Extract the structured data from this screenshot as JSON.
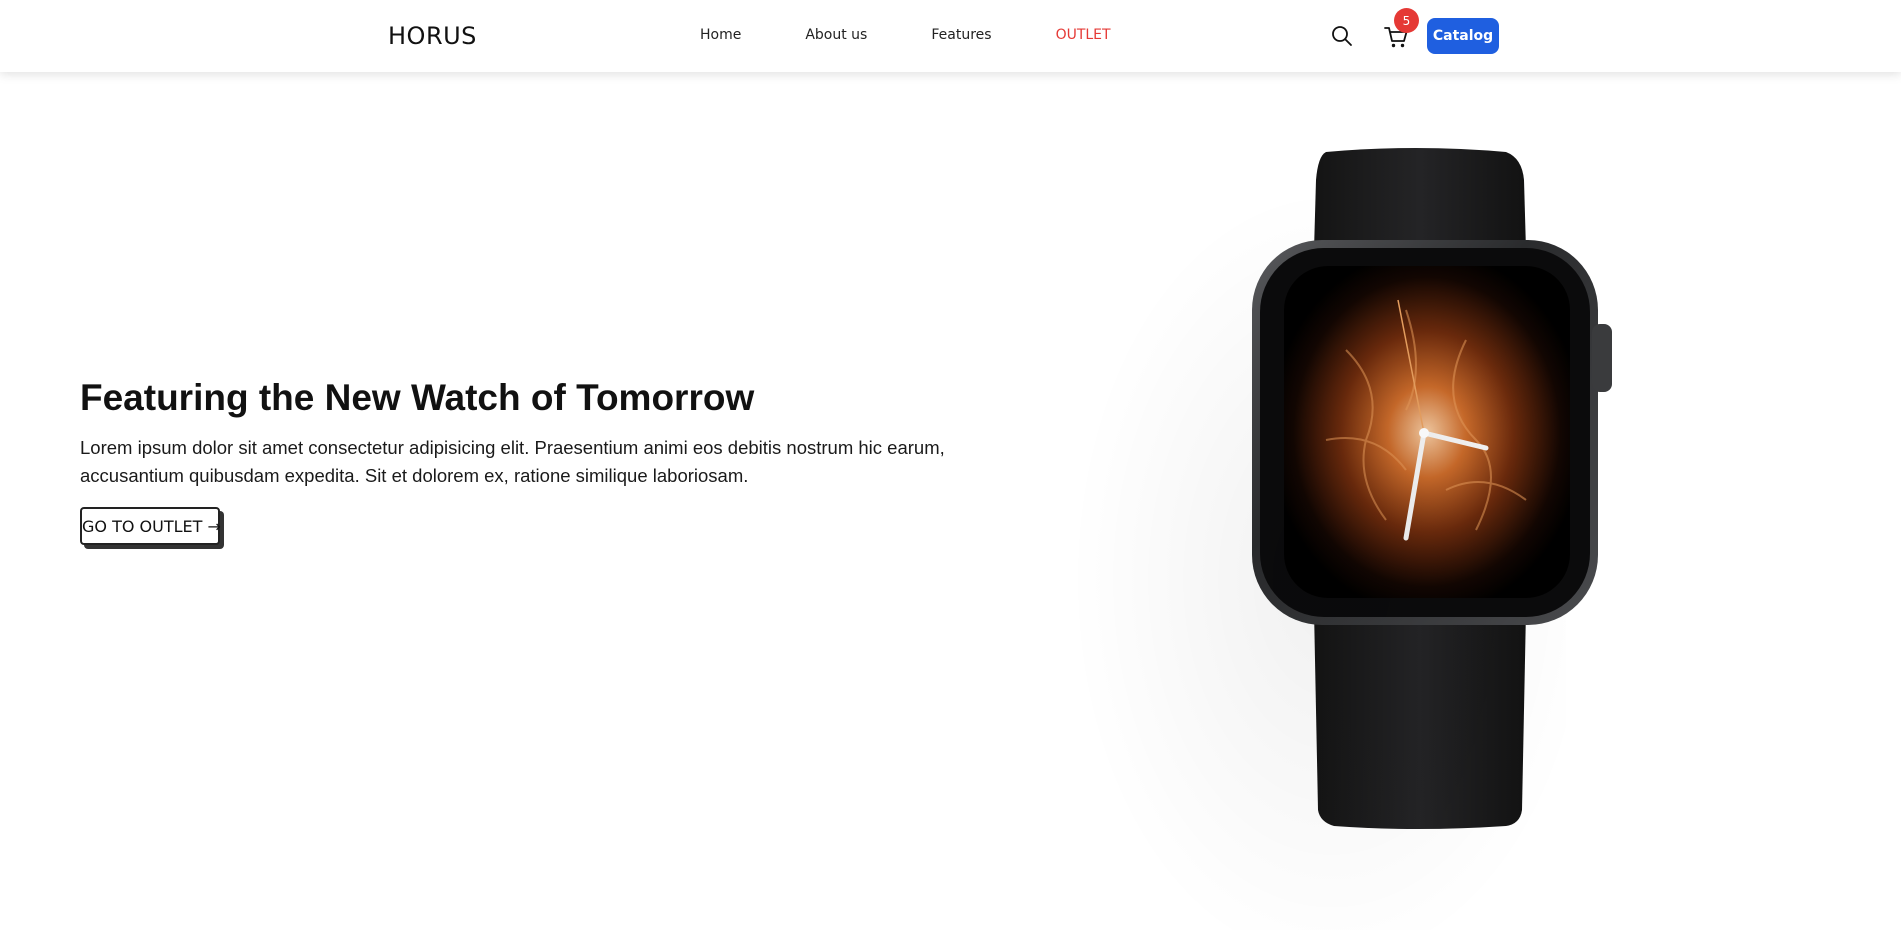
{
  "brand": "HORUS",
  "nav": {
    "links": [
      {
        "label": "Home"
      },
      {
        "label": "About us"
      },
      {
        "label": "Features"
      },
      {
        "label": "OUTLET"
      }
    ],
    "cart_count": "5",
    "catalog_label": "Catalog"
  },
  "hero": {
    "title": "Featuring the New Watch of Tomorrow",
    "description": "Lorem ipsum dolor sit amet consectetur adipisicing elit. Praesentium animi eos debitis nostrum hic earum, accusantium quibusdam expedita. Sit et dolorem ex, ratione similique laboriosam.",
    "cta_label": "GO TO OUTLET →"
  },
  "colors": {
    "accent_blue": "#1f5fe0",
    "outlet_red": "#e53935"
  },
  "icons": [
    "search-icon",
    "cart-icon"
  ]
}
